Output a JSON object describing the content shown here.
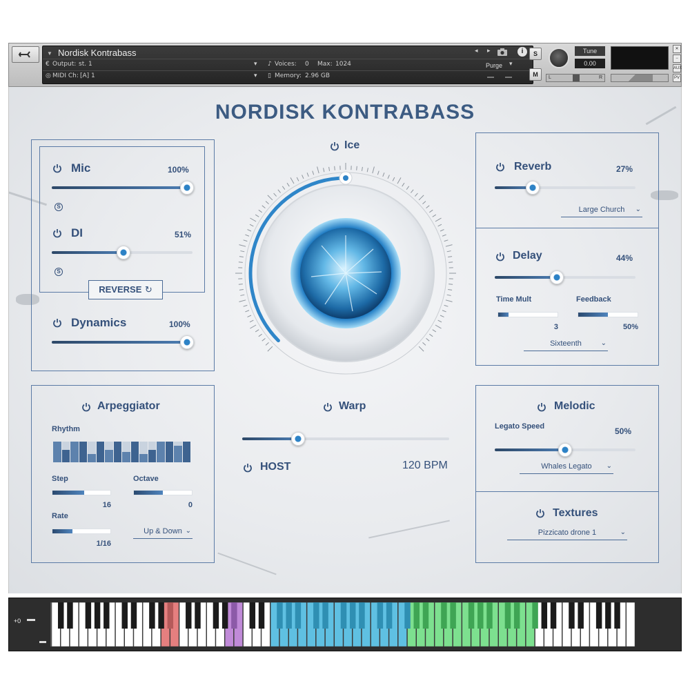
{
  "header": {
    "instrument_name": "Nordisk Kontrabass",
    "output_label": "Output:",
    "output_value": "st. 1",
    "midi_label": "MIDI Ch:",
    "midi_value": "[A] 1",
    "voices_label": "Voices:",
    "voices_value": "0",
    "max_label": "Max:",
    "max_value": "1024",
    "memory_label": "Memory:",
    "memory_value": "2.96 GB",
    "purge_label": "Purge",
    "solo_label": "S",
    "mute_label": "M",
    "tune_label": "Tune",
    "tune_value": "0.00",
    "pan_left": "L",
    "pan_right": "R",
    "aux_label": "AUX",
    "pv_label": "PV"
  },
  "main": {
    "title": "NORDISK KONTRABASS",
    "mic": {
      "label": "Mic",
      "value": "100%",
      "level": 1.0
    },
    "di": {
      "label": "DI",
      "value": "51%",
      "level": 0.51
    },
    "reverse_label": "REVERSE",
    "dynamics": {
      "label": "Dynamics",
      "value": "100%",
      "level": 1.0
    },
    "ice": {
      "label": "Ice",
      "level": 0.5
    },
    "warp": {
      "label": "Warp",
      "level": 0.27
    },
    "host_label": "HOST",
    "bpm": "120 BPM",
    "reverb": {
      "label": "Reverb",
      "value": "27%",
      "level": 0.27,
      "type": "Large Church"
    },
    "delay": {
      "label": "Delay",
      "value": "44%",
      "level": 0.44,
      "time_mult_label": "Time Mult",
      "time_mult_value": "3",
      "time_mult_level": 0.18,
      "feedback_label": "Feedback",
      "feedback_value": "50%",
      "feedback_level": 0.5,
      "division": "Sixteenth"
    },
    "arpeggiator": {
      "label": "Arpeggiator",
      "rhythm_label": "Rhythm",
      "rhythm_steps": [
        1,
        0.6,
        1,
        1,
        0.4,
        1,
        0.6,
        1,
        0.5,
        1,
        0.4,
        0.6,
        1,
        1,
        0.8,
        1
      ],
      "step_label": "Step",
      "step_value": "16",
      "step_level": 0.55,
      "octave_label": "Octave",
      "octave_value": "0",
      "octave_level": 0.5,
      "rate_label": "Rate",
      "rate_value": "1/16",
      "rate_level": 0.35,
      "direction": "Up & Down"
    },
    "melodic": {
      "label": "Melodic",
      "legato_label": "Legato Speed",
      "legato_value": "50%",
      "level": 0.5,
      "preset": "Whales Legato"
    },
    "textures": {
      "label": "Textures",
      "preset": "Pizzicato drone 1"
    }
  },
  "keyboard": {
    "octave": "+0"
  },
  "colors": {
    "accent": "#34507a",
    "slider": "#2d82c6",
    "key_red": "#e57f7f",
    "key_purple": "#c08ad8",
    "key_blue": "#5fc0e2",
    "key_green": "#7de08f"
  }
}
